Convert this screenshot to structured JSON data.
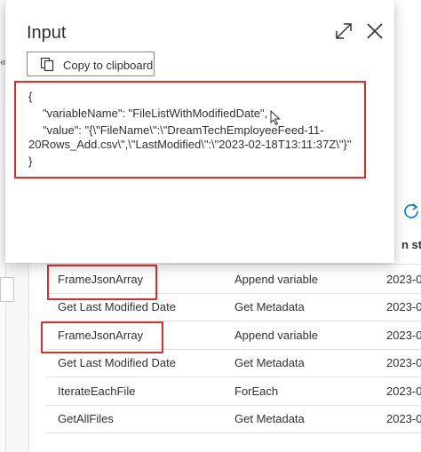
{
  "panel": {
    "title": "Input",
    "copy_label": "Copy to clipboard",
    "json_lines": [
      "{",
      "\"variableName\": \"FileListWithModifiedDate\",",
      "\"value\": \"{\\\"FileName\\\":\\\"DreamTechEmployeeFeed-11-",
      "20Rows_Add.csv\\\",\\\"LastModified\\\":\\\"2023-02-18T13:11:37Z\\\"}\"",
      "}"
    ]
  },
  "background": {
    "column_header_partial": "n sta",
    "chevron": "«"
  },
  "activity_rows": [
    {
      "name": "FrameJsonArray",
      "type": "Append variable",
      "start": "2023-0",
      "highlighted": true
    },
    {
      "name": "Get Last Modified Date",
      "type": "Get Metadata",
      "start": "2023-0",
      "highlighted": false
    },
    {
      "name": "FrameJsonArray",
      "type": "Append variable",
      "start": "2023-0",
      "highlighted": true
    },
    {
      "name": "Get Last Modified Date",
      "type": "Get Metadata",
      "start": "2023-0",
      "highlighted": false
    },
    {
      "name": "IterateEachFile",
      "type": "ForEach",
      "start": "2023-0",
      "highlighted": false
    },
    {
      "name": "GetAllFiles",
      "type": "Get Metadata",
      "start": "2023-0",
      "highlighted": false
    }
  ],
  "colors": {
    "highlight": "#d9302f",
    "accent": "#0078d4"
  },
  "icons": {
    "expand": "expand-icon",
    "close": "close-icon",
    "copy": "copy-icon",
    "refresh": "refresh-icon",
    "cursor": "mouse-pointer-icon"
  }
}
